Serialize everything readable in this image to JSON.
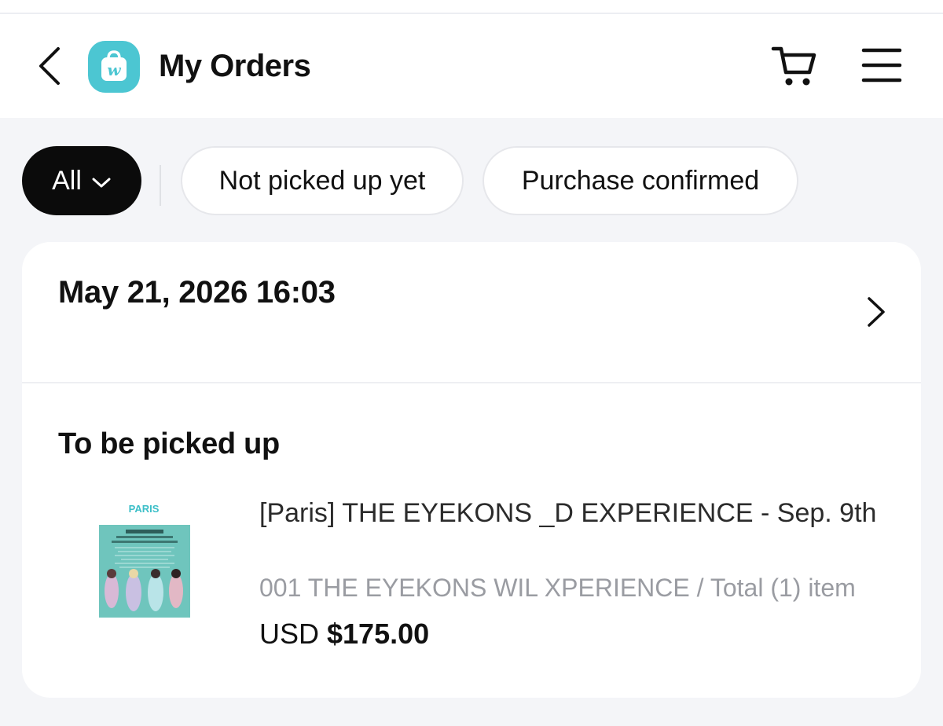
{
  "header": {
    "title": "My Orders",
    "logo_letter": "w",
    "accent_color": "#4cc6d2"
  },
  "filters": {
    "all_label": "All",
    "not_picked_label": "Not picked up yet",
    "confirmed_label": "Purchase confirmed"
  },
  "order": {
    "date": "May 21, 2026 16:03",
    "status": "To be picked up",
    "thumbnail_label": "PARIS",
    "product_name": "[Paris] THE EYEKONS   _D EXPERIENCE - Sep. 9th",
    "option_summary": "001 THE EYEKONS WIL   XPERIENCE / Total (1) item",
    "currency": "USD",
    "price": "$175.00"
  },
  "icons": {
    "back": "chevron-left-icon",
    "logo": "shopping-bag-icon",
    "cart": "cart-icon",
    "menu": "hamburger-menu-icon",
    "filter_dropdown": "chevron-down-icon",
    "order_detail": "chevron-right-icon"
  }
}
